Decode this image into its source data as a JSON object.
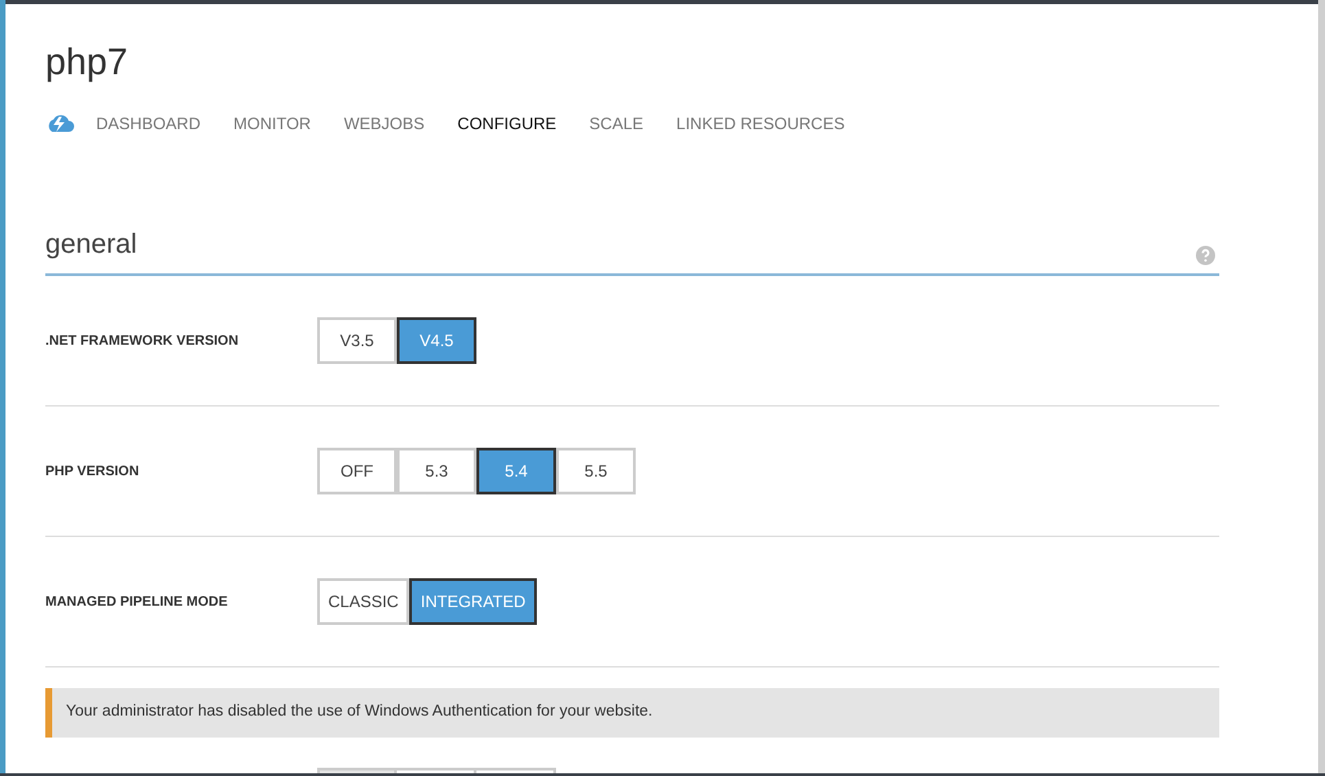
{
  "title": "php7",
  "tabs": [
    {
      "label": "DASHBOARD",
      "selected": false
    },
    {
      "label": "MONITOR",
      "selected": false
    },
    {
      "label": "WEBJOBS",
      "selected": false
    },
    {
      "label": "CONFIGURE",
      "selected": true
    },
    {
      "label": "SCALE",
      "selected": false
    },
    {
      "label": "LINKED RESOURCES",
      "selected": false
    }
  ],
  "section": {
    "title": "general"
  },
  "settings": [
    {
      "label": ".NET FRAMEWORK VERSION",
      "options": [
        {
          "label": "V3.5",
          "selected": false
        },
        {
          "label": "V4.5",
          "selected": true
        }
      ]
    },
    {
      "label": "PHP VERSION",
      "options": [
        {
          "label": "OFF",
          "selected": false
        },
        {
          "label": "5.3",
          "selected": false
        },
        {
          "label": "5.4",
          "selected": true
        },
        {
          "label": "5.5",
          "selected": false
        }
      ]
    },
    {
      "label": "MANAGED PIPELINE MODE",
      "options": [
        {
          "label": "CLASSIC",
          "selected": false
        },
        {
          "label": "INTEGRATED",
          "selected": true
        }
      ]
    }
  ],
  "alert": {
    "text": "Your administrator has disabled the use of Windows Authentication for your website."
  }
}
